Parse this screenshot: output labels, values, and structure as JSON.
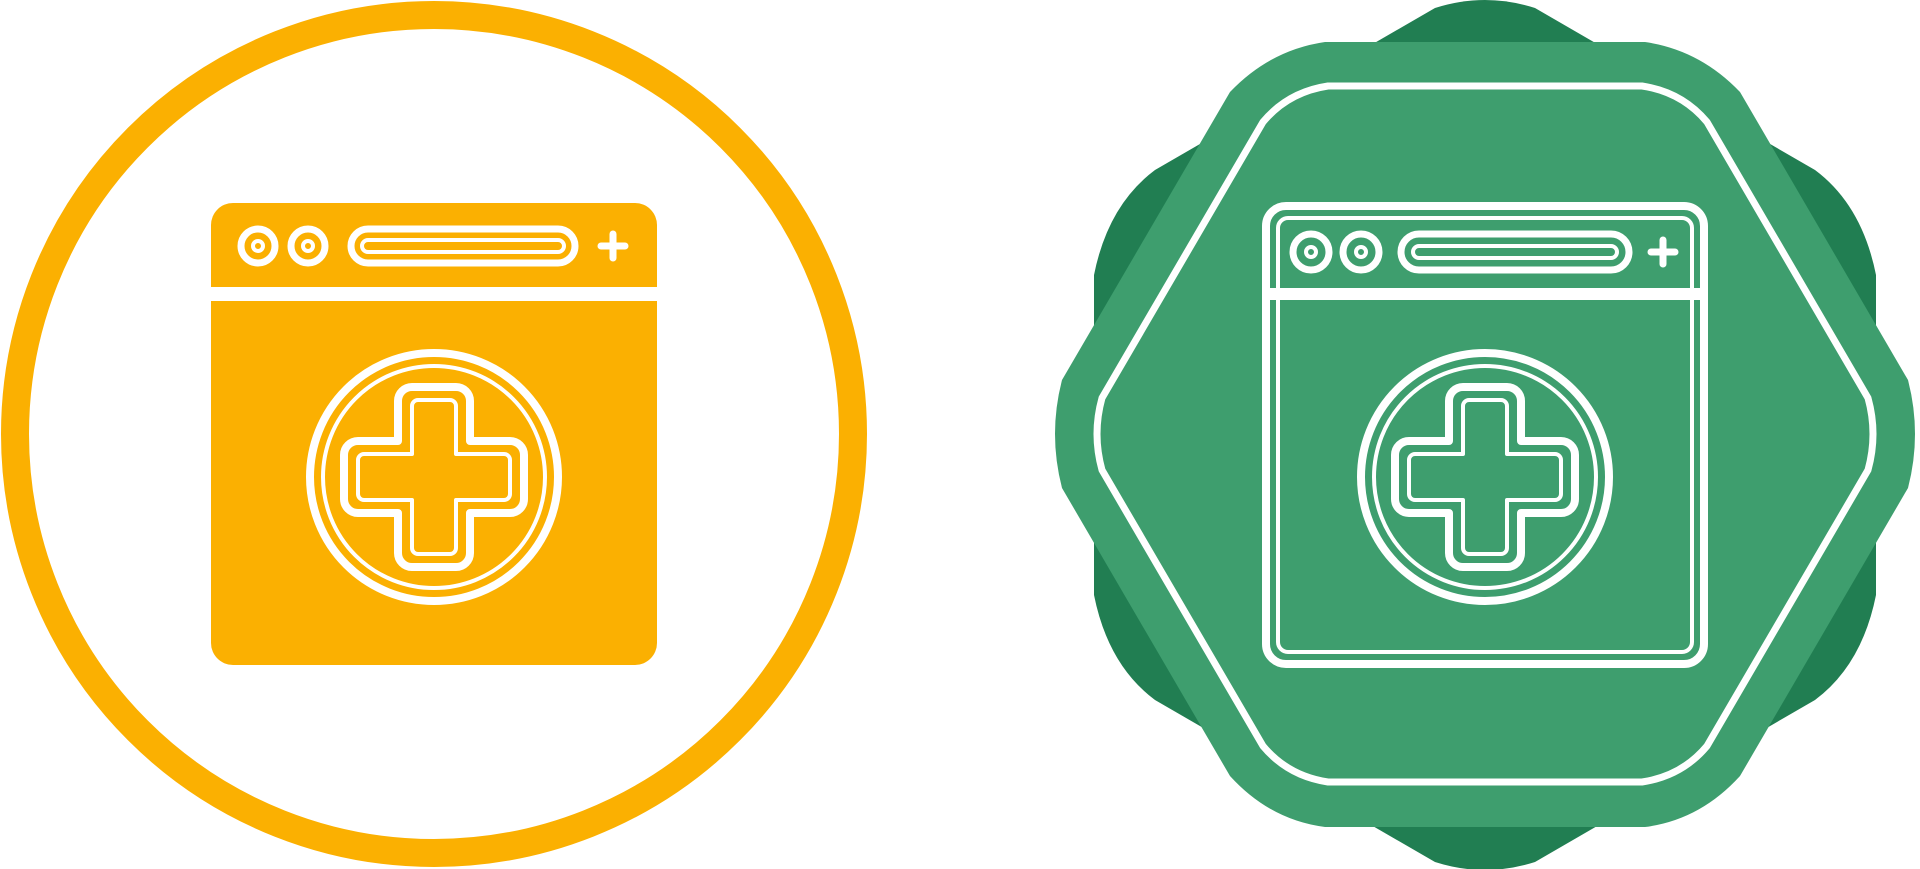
{
  "icons": [
    {
      "id": "yellow",
      "name": "medical-browser-icon-solid",
      "badge_shape": "circle",
      "style": "glyph",
      "colors": {
        "primary": "#FBB001",
        "background": "#FFFFFF",
        "line": "#FFFFFF"
      }
    },
    {
      "id": "green",
      "name": "medical-browser-icon-line",
      "badge_shape": "octagonal-seal",
      "style": "outline",
      "colors": {
        "primary": "#3E9E6E",
        "shadow": "#217E52",
        "line": "#FFFFFF"
      }
    }
  ]
}
